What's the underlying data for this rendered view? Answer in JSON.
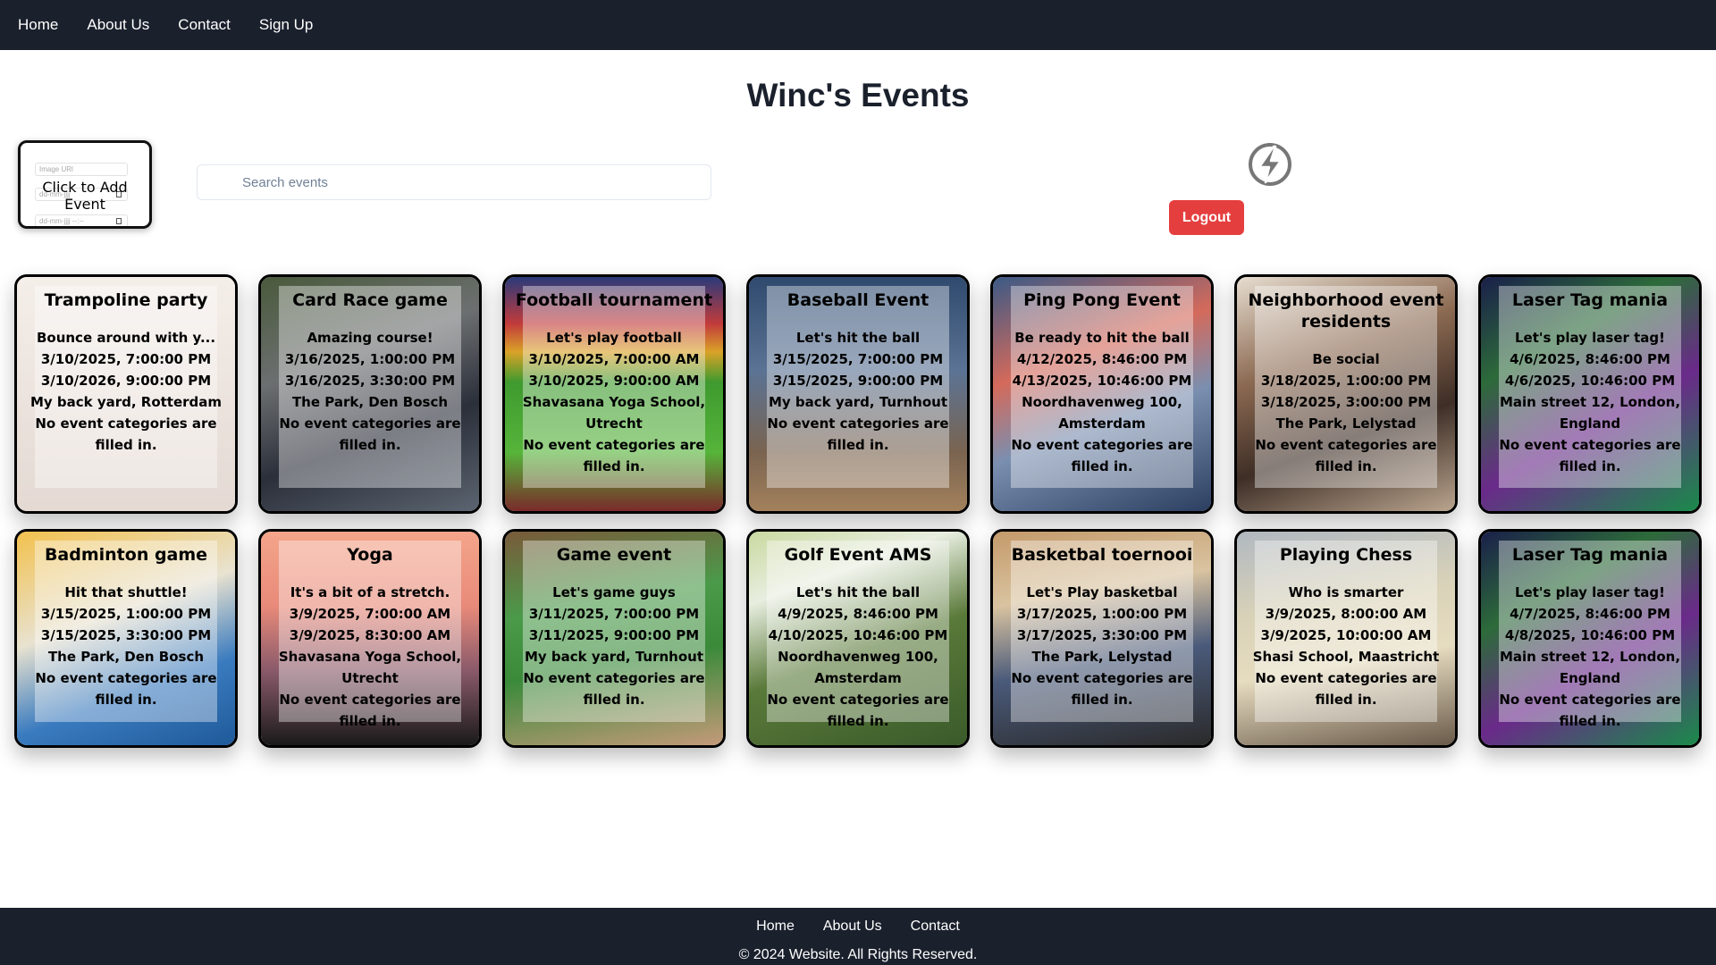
{
  "nav": {
    "home": "Home",
    "about": "About Us",
    "contact": "Contact",
    "signup": "Sign Up"
  },
  "title": "Winc's Events",
  "add_event": {
    "label": "Click to Add Event",
    "image_url_placeholder": "Image URl",
    "date_placeholder_1": "dd-mm-jjjj",
    "date_placeholder_2": "dd-mm-jjjj --:--"
  },
  "search": {
    "placeholder": "Search events"
  },
  "logo_icon": "lightning-bolt-icon",
  "logout_label": "Logout",
  "colors": {
    "nav_bg": "#1a202c",
    "logout": "#e53e3e"
  },
  "events": [
    {
      "title": "Trampoline party",
      "description": "Bounce around with y...",
      "start": "3/10/2025, 7:00:00 PM",
      "end": "3/10/2026, 9:00:00 PM",
      "location": "My back yard, Rotterdam",
      "categories": "No event categories are filled in.",
      "bg": "linear-gradient(180deg,#f4eee9 0%,#e4d9d3 100%)"
    },
    {
      "title": "Card Race game",
      "description": "Amazing course!",
      "start": "3/16/2025, 1:00:00 PM",
      "end": "3/16/2025, 3:30:00 PM",
      "location": "The Park, Den Bosch",
      "categories": "No event categories are filled in.",
      "bg": "linear-gradient(160deg,#4a5a3c 0%,#6c6f70 35%,#2b2f3a 65%,#5b6470 100%)"
    },
    {
      "title": "Football tournament",
      "description": "Let's play football",
      "start": "3/10/2025, 7:00:00 AM",
      "end": "3/10/2025, 9:00:00 AM",
      "location": "Shavasana Yoga School, Utrecht",
      "categories": "No event categories are filled in.",
      "bg": "linear-gradient(180deg,#2a3a7a 0%,#c23b3b 20%,#d9a227 32%,#3f9a2f 45%,#56b43a 75%,#7a2a2a 100%)"
    },
    {
      "title": "Baseball Event",
      "description": "Let's hit the ball",
      "start": "3/15/2025, 7:00:00 PM",
      "end": "3/15/2025, 9:00:00 PM",
      "location": "My back yard, Turnhout",
      "categories": "No event categories are filled in.",
      "bg": "linear-gradient(180deg,#2f4a6e 0%,#5b7394 40%,#7a6450 75%,#a3815c 100%)"
    },
    {
      "title": "Ping Pong Event",
      "description": "Be ready to hit the ball",
      "start": "4/12/2025, 8:46:00 PM",
      "end": "4/13/2025, 10:46:00 PM",
      "location": "Noordhavenweg 100, Amsterdam",
      "categories": "No event categories are filled in.",
      "bg": "linear-gradient(160deg,#3b5a86 0%,#d46a5b 35%,#7a8fb0 60%,#2c3f60 100%)"
    },
    {
      "title": "Neighborhood event residents",
      "description": "Be social",
      "start": "3/18/2025, 1:00:00 PM",
      "end": "3/18/2025, 3:00:00 PM",
      "location": "The Park, Lelystad",
      "categories": "No event categories are filled in.",
      "bg": "linear-gradient(160deg,#e6ddd0 0%,#8c6a52 35%,#3e2e26 65%,#b9a48e 100%)"
    },
    {
      "title": "Laser Tag mania",
      "description": "Let's play laser tag!",
      "start": "4/6/2025, 8:46:00 PM",
      "end": "4/6/2025, 10:46:00 PM",
      "location": "Main street 12, London, England",
      "categories": "No event categories are filled in.",
      "bg": "linear-gradient(150deg,#1a1f4a 0%,#2d6b3a 30%,#6a2a8a 60%,#1a8a4a 100%)"
    },
    {
      "title": "Badminton game",
      "description": "Hit that shuttle!",
      "start": "3/15/2025, 1:00:00 PM",
      "end": "3/15/2025, 3:30:00 PM",
      "location": "The Park, Den Bosch",
      "categories": "No event categories are filled in.",
      "bg": "linear-gradient(160deg,#f2c14e 0%,#e8e2d0 40%,#3a7bbf 70%,#1f5a9a 100%)"
    },
    {
      "title": "Yoga",
      "description": "It's a bit of a stretch.",
      "start": "3/9/2025, 7:00:00 AM",
      "end": "3/9/2025, 8:30:00 AM",
      "location": "Shavasana Yoga School, Utrecht",
      "categories": "No event categories are filled in.",
      "bg": "linear-gradient(180deg,#f4a58a 0%,#e88a7a 35%,#8a5a6a 65%,#1a1a1a 100%)"
    },
    {
      "title": "Game event",
      "description": "Let's game guys",
      "start": "3/11/2025, 7:00:00 PM",
      "end": "3/11/2025, 9:00:00 PM",
      "location": "My back yard, Turnhout",
      "categories": "No event categories are filled in.",
      "bg": "linear-gradient(170deg,#7a5a3a 0%,#4a9a4a 35%,#3a8a3a 60%,#c49a7a 100%)"
    },
    {
      "title": "Golf Event AMS",
      "description": "Let's hit the ball",
      "start": "4/9/2025, 8:46:00 PM",
      "end": "4/10/2025, 10:46:00 PM",
      "location": "Noordhavenweg 100, Amsterdam",
      "categories": "No event categories are filled in.",
      "bg": "linear-gradient(160deg,#c9d9a0 0%,#e8eee0 25%,#5a7a3a 55%,#3a5a2a 100%)"
    },
    {
      "title": "Basketbal toernooi",
      "description": "Let's Play basketbal",
      "start": "3/17/2025, 1:00:00 PM",
      "end": "3/17/2025, 3:30:00 PM",
      "location": "The Park, Lelystad",
      "categories": "No event categories are filled in.",
      "bg": "linear-gradient(170deg,#c49a6a 0%,#d9c3a0 30%,#4a5a7a 60%,#2a2a2a 100%)"
    },
    {
      "title": "Playing Chess",
      "description": "Who is smarter",
      "start": "3/9/2025, 8:00:00 AM",
      "end": "3/9/2025, 10:00:00 AM",
      "location": "Shasi School, Maastricht",
      "categories": "No event categories are filled in.",
      "bg": "linear-gradient(170deg,#b0b8c0 0%,#d9d2b8 35%,#e6dcc0 60%,#6a5a4a 100%)"
    },
    {
      "title": "Laser Tag mania",
      "description": "Let's play laser tag!",
      "start": "4/7/2025, 8:46:00 PM",
      "end": "4/8/2025, 10:46:00 PM",
      "location": "Main street 12, London, England",
      "categories": "No event categories are filled in.",
      "bg": "linear-gradient(150deg,#1a1f4a 0%,#2d6b3a 30%,#6a2a8a 60%,#1a8a4a 100%)"
    }
  ],
  "footer": {
    "home": "Home",
    "about": "About Us",
    "contact": "Contact",
    "copyright": "© 2024 Website. All Rights Reserved."
  }
}
